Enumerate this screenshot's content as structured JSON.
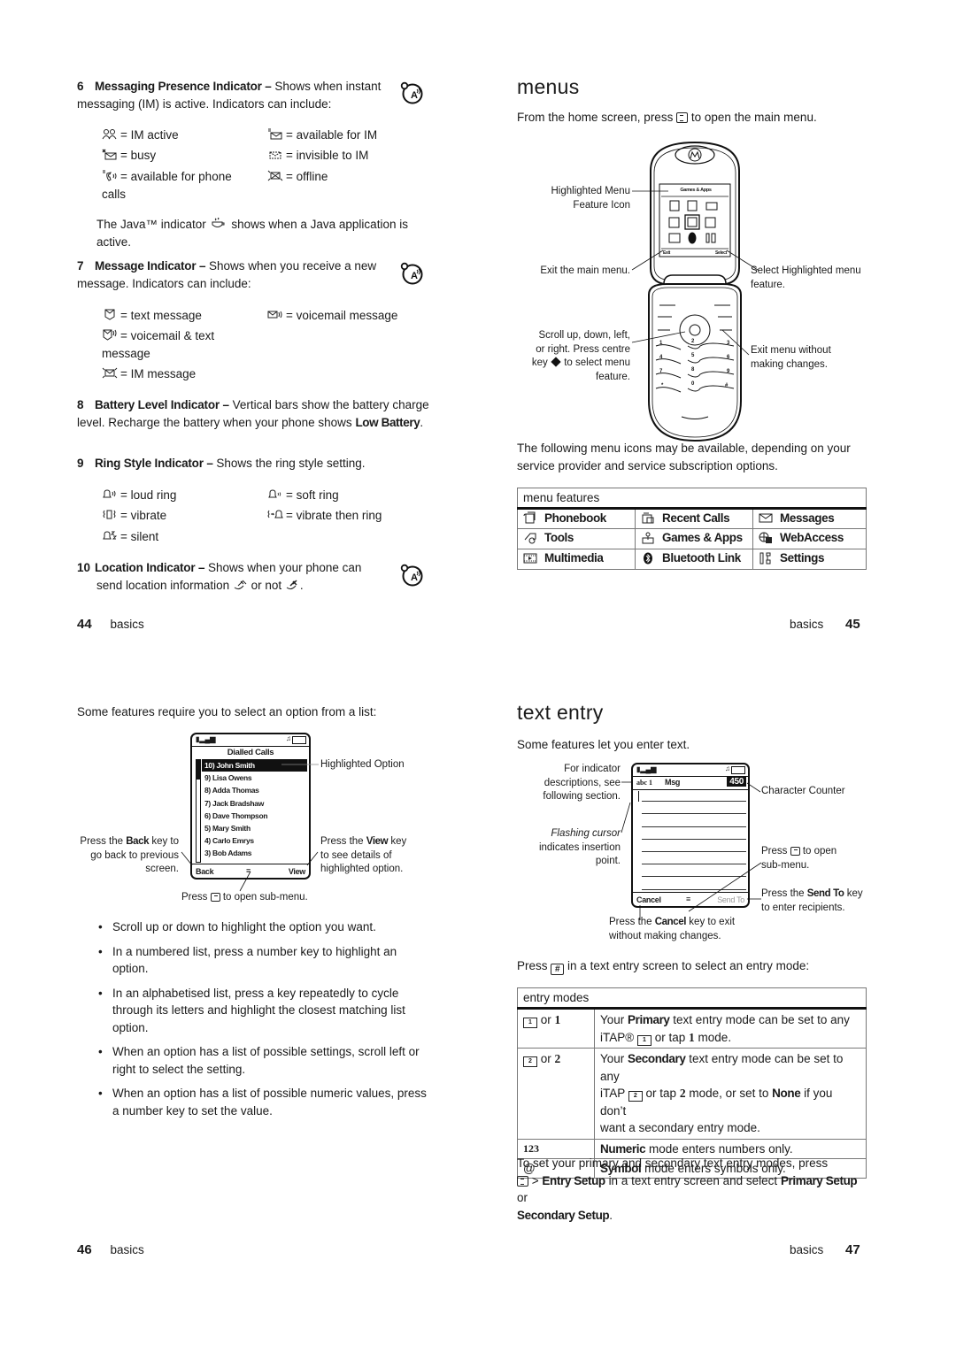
{
  "page44": {
    "items": [
      {
        "number": "6",
        "title": "Messaging Presence Indicator –",
        "text": "Shows when instant messaging (IM) is active. Indicators can include:",
        "indicators": [
          {
            "icon": "im-active-icon",
            "label": "= IM active"
          },
          {
            "icon": "available-for-im-icon",
            "label": "= available for IM"
          },
          {
            "icon": "busy-icon",
            "label": "= busy"
          },
          {
            "icon": "invisible-to-im-icon",
            "label": "= invisible to IM"
          },
          {
            "icon": "available-for-phone-calls-icon",
            "label": "= available for phone",
            "label2": "calls"
          },
          {
            "icon": "offline-icon",
            "label": "= offline"
          }
        ],
        "java_note_1": "The Java™ indicator",
        "java_note_2": "shows when a Java application is",
        "java_note_3": "active."
      },
      {
        "number": "7",
        "title": "Message Indicator –",
        "text": "Shows when you receive a new message. Indicators can include:",
        "indicators": [
          {
            "icon": "text-message-icon",
            "label": "= text message"
          },
          {
            "icon": "voicemail-message-icon",
            "label": "= voicemail message"
          },
          {
            "icon": "voicemail-and-text-icon",
            "label": "= voicemail & text",
            "label2": "message"
          },
          {
            "icon": "im-message-icon",
            "label": "= IM message"
          }
        ]
      },
      {
        "number": "8",
        "title": "Battery Level Indicator –",
        "text": "Vertical bars show the battery charge level. Recharge the battery when your phone shows",
        "emph": "Low Battery",
        "tail": "."
      },
      {
        "number": "9",
        "title": "Ring Style Indicator –",
        "text": "Shows the ring style setting.",
        "indicators": [
          {
            "icon": "loud-ring-icon",
            "label": "= loud ring"
          },
          {
            "icon": "soft-ring-icon",
            "label": "= soft ring"
          },
          {
            "icon": "vibrate-icon",
            "label": "= vibrate"
          },
          {
            "icon": "vibrate-then-ring-icon",
            "label": "= vibrate then ring"
          },
          {
            "icon": "silent-icon",
            "label": "= silent"
          }
        ]
      },
      {
        "number": "10",
        "title": "Location Indicator –",
        "text": "Shows when your phone can",
        "text2": "send location information",
        "text3": "or not",
        "text4": "."
      }
    ],
    "footer": {
      "number": "44",
      "section": "basics"
    }
  },
  "page45": {
    "heading": "menus",
    "intro_1": "From the home screen, press",
    "intro_2": "to open the main menu.",
    "figure": {
      "screen_title": "Games & Apps",
      "softkey_left": "Exit",
      "softkey_right": "Select",
      "callouts": {
        "highlighted_1": "Highlighted Menu",
        "highlighted_2": "Feature Icon",
        "exit": "Exit the main menu.",
        "select_1": "Select Highlighted menu",
        "select_2": "feature.",
        "scroll_1": "Scroll up, down, left,",
        "scroll_2": "or right. Press centre",
        "scroll_3a": "key",
        "scroll_3b": "to select menu",
        "scroll_4": "feature.",
        "exitnochange_1": "Exit menu without",
        "exitnochange_2": "making changes."
      },
      "keys": [
        "1",
        "2",
        "3",
        "4",
        "5",
        "6",
        "7",
        "8",
        "9",
        "*",
        "0",
        "#"
      ]
    },
    "para": "The following menu icons may be available, depending on your service provider and service subscription options.",
    "table": {
      "header": "menu features",
      "rows": [
        [
          {
            "icon": "phonebook-icon",
            "label": "Phonebook"
          },
          {
            "icon": "recent-calls-icon",
            "label": "Recent Calls"
          },
          {
            "icon": "messages-icon",
            "label": "Messages"
          }
        ],
        [
          {
            "icon": "tools-icon",
            "label": "Tools"
          },
          {
            "icon": "games-apps-icon",
            "label": "Games & Apps"
          },
          {
            "icon": "webaccess-icon",
            "label": "WebAccess"
          }
        ],
        [
          {
            "icon": "multimedia-icon",
            "label": "Multimedia"
          },
          {
            "icon": "bluetooth-icon",
            "label": "Bluetooth Link"
          },
          {
            "icon": "settings-icon",
            "label": "Settings"
          }
        ]
      ]
    },
    "footer": {
      "number": "45",
      "section": "basics"
    }
  },
  "page46": {
    "intro": "Some features require you to select an option from a list:",
    "figure": {
      "screen_title": "Dialled Calls",
      "list": [
        "10) John Smith",
        "9) Lisa Owens",
        "8) Adda Thomas",
        "7) Jack Bradshaw",
        "6) Dave Thompson",
        "5) Mary Smith",
        "4) Carlo Emrys",
        "3) Bob Adams"
      ],
      "highlighted_index": 0,
      "softkey_left": "Back",
      "softkey_right": "View",
      "callouts": {
        "highlighted": "Highlighted Option",
        "back_1a": "Press the",
        "back_1b": "Back",
        "back_1c": "key to",
        "back_2": "go back to previous",
        "back_3": "screen.",
        "view_1a": "Press the",
        "view_1b": "View",
        "view_1c": "key",
        "view_2": "to see details of",
        "view_3": "highlighted option.",
        "submenu_a": "Press",
        "submenu_b": "to open sub-menu."
      }
    },
    "bullets": [
      "Scroll up or down to highlight the option you want.",
      "In a numbered list, press a number key to highlight an option.",
      "In an alphabetised list, press a key repeatedly to cycle through its letters and highlight the closest matching list option.",
      "When an option has a list of possible settings, scroll left or right to select the setting.",
      "When an option has a list of possible numeric values, press a number key to set the value."
    ],
    "footer": {
      "number": "46",
      "section": "basics"
    }
  },
  "page47": {
    "heading": "text entry",
    "intro": "Some features let you enter text.",
    "figure": {
      "mode_indicator": "abc 1",
      "msg_label": "Msg",
      "counter": "450",
      "softkey_left": "Cancel",
      "softkey_right": "Send To",
      "callouts": {
        "indicator_1": "For indicator",
        "indicator_2": "descriptions, see",
        "indicator_3": "following section.",
        "counter": "Character Counter",
        "cursor_1": "Flashing cursor",
        "cursor_2": "indicates insertion",
        "cursor_3": "point.",
        "submenu_1a": "Press",
        "submenu_1b": "to open",
        "submenu_2": "sub-menu.",
        "sendto_1a": "Press the",
        "sendto_1b": "Send To",
        "sendto_1c": "key",
        "sendto_2": "to enter recipients.",
        "cancel_1a": "Press the",
        "cancel_1b": "Cancel",
        "cancel_1c": "key to exit",
        "cancel_2": "without making changes."
      }
    },
    "press_hash_a": "Press",
    "press_hash_b": "in a text entry screen to select an entry mode:",
    "table": {
      "header": "entry modes",
      "rows": [
        {
          "mode": "or",
          "mode_key": "1",
          "desc_a": "Your",
          "desc_b": "Primary",
          "desc_c": "text entry mode can be set to any",
          "desc_d": "iTAP®",
          "desc_e": "or tap",
          "desc_f": "1",
          "desc_g": "mode."
        },
        {
          "mode": "or",
          "mode_key": "2",
          "desc_a": "Your",
          "desc_b": "Secondary",
          "desc_c": "text entry mode can be set to any",
          "desc_d": "iTAP",
          "desc_e": "or tap",
          "desc_f": "2",
          "desc_g": "mode, or set to",
          "desc_h": "None",
          "desc_i": "if you don’t",
          "desc_j": "want a secondary entry mode."
        },
        {
          "mode": "123",
          "desc_b": "Numeric",
          "desc_c": "mode enters numbers only."
        },
        {
          "mode": "@",
          "desc_b": "Symbol",
          "desc_c": "mode enters symbols only."
        }
      ]
    },
    "outro_1": "To set your primary and secondary text entry modes, press",
    "outro_2a": ">",
    "outro_2b": "Entry Setup",
    "outro_2c": "in a text entry screen and select",
    "outro_2d": "Primary Setup",
    "outro_2e": "or",
    "outro_3": "Secondary Setup",
    "outro_4": ".",
    "footer": {
      "number": "47",
      "section": "basics"
    }
  }
}
